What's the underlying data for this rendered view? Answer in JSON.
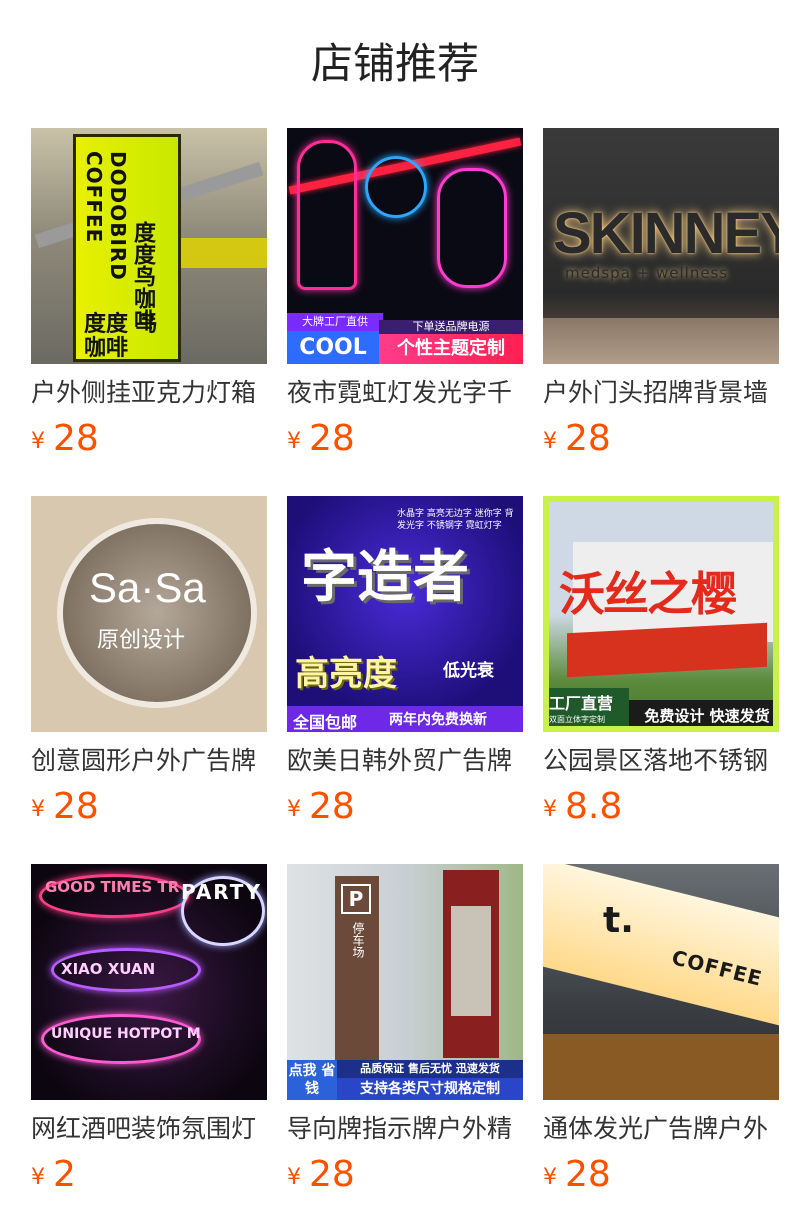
{
  "section_title": "店铺推荐",
  "currency_symbol": "¥",
  "products": [
    {
      "name": "户外侧挂亚克力灯箱",
      "price": "28",
      "image_text": {
        "brand_v": "DODOBIRD COFFEE",
        "brand_cn": "度度鸟咖啡",
        "small": "度度 鸟咖啡"
      }
    },
    {
      "name": "夜市霓虹灯发光字千",
      "price": "28",
      "image_text": {
        "tag_top": "大牌工厂直供",
        "tag_big": "COOL",
        "tag_r_top": "下单送品牌电源",
        "tag_r_big": "个性主题定制"
      }
    },
    {
      "name": "户外门头招牌背景墙",
      "price": "28",
      "image_text": {
        "big": "SKINNEY",
        "small": "medspa + wellness"
      }
    },
    {
      "name": "创意圆形户外广告牌",
      "price": "28",
      "image_text": {
        "brand": "Sa·Sa",
        "sub": "原创设计"
      }
    },
    {
      "name": "欧美日韩外贸广告牌",
      "price": "28",
      "image_text": {
        "tags": "水晶字 高亮无边字 迷你字 背发光字 不锈钢字 霓虹灯字",
        "big": "字造者",
        "mid": "高亮度",
        "right": "低光衰",
        "bar_left": "全国包邮",
        "bar_right": "两年内免费换新"
      }
    },
    {
      "name": "公园景区落地不锈钢",
      "price": "8.8",
      "image_text": {
        "chars": "沃丝之樱",
        "badge": "工厂直营",
        "badge_sub": "双面立体字定制",
        "bar": "免费设计 快速发货"
      }
    },
    {
      "name": "网红酒吧装饰氛围灯",
      "price": "2",
      "image_text": {
        "w1": "GOOD TIMES TR",
        "w2": "PARTY",
        "w3": "XIAO XUAN",
        "w4": "UNIQUE HOTPOT M"
      }
    },
    {
      "name": "导向牌指示牌户外精",
      "price": "28",
      "image_text": {
        "p": "P",
        "parking": "停车场",
        "b1": "点我 省钱",
        "b2": "品质保证 售后无忧 迅速发货",
        "b3": "支持各类尺寸规格定制"
      }
    },
    {
      "name": "通体发光广告牌户外",
      "price": "28",
      "image_text": {
        "t": "t.",
        "coffee": "COFFEE"
      }
    }
  ]
}
